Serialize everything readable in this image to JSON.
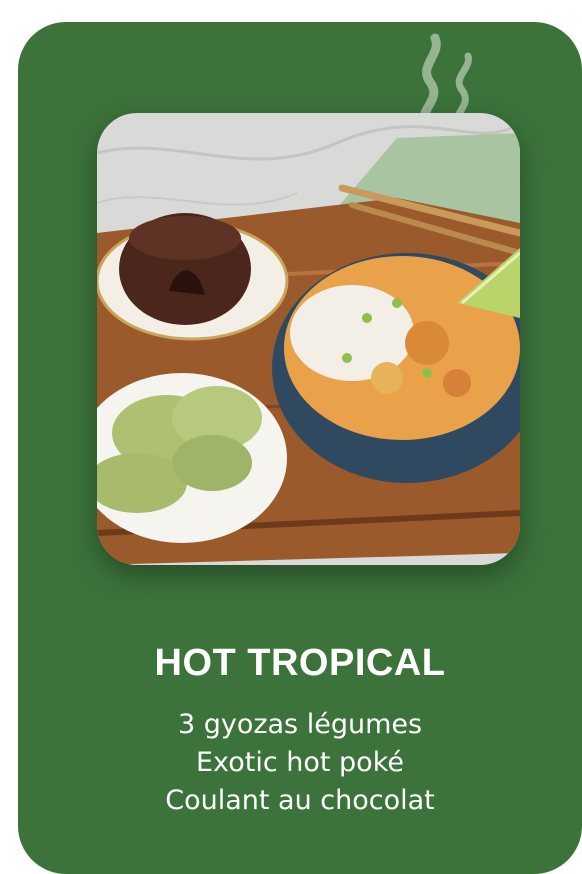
{
  "card": {
    "title": "HOT TROPICAL",
    "items": [
      "3 gyozas légumes",
      "Exotic hot poké",
      "Coulant au chocolat"
    ],
    "background_color": "#3b733b",
    "text_color": "#ffffff"
  }
}
